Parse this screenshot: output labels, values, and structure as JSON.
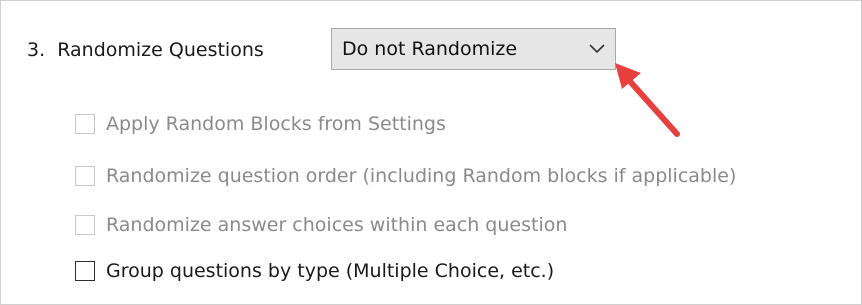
{
  "question": {
    "number_label": "3.",
    "title": "Randomize Questions",
    "selected_option": "Do not Randomize"
  },
  "options": [
    {
      "label": "Apply Random Blocks from Settings",
      "enabled": false,
      "checked": false
    },
    {
      "label": "Randomize question order (including Random blocks if applicable)",
      "enabled": false,
      "checked": false
    },
    {
      "label": "Randomize answer choices within each question",
      "enabled": false,
      "checked": false
    },
    {
      "label": "Group questions by type (Multiple Choice, etc.)",
      "enabled": true,
      "checked": false
    }
  ],
  "annotation": {
    "arrow_color": "#e8403e"
  }
}
